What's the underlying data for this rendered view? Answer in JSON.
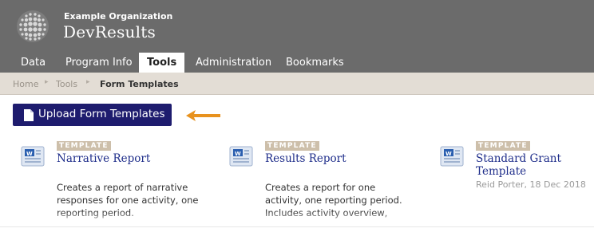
{
  "header": {
    "organization": "Example Organization",
    "app_name": "DevResults",
    "logo_icon": "dot-grid-logo-icon",
    "background": "#6b6b6b"
  },
  "nav": {
    "tabs": [
      {
        "label": "Data",
        "active": false
      },
      {
        "label": "Program Info",
        "active": false
      },
      {
        "label": "Tools",
        "active": true
      },
      {
        "label": "Administration",
        "active": false
      },
      {
        "label": "Bookmarks",
        "active": false
      }
    ]
  },
  "breadcrumb": {
    "items": [
      "Home",
      "Tools",
      "Form Templates"
    ],
    "separator_icon": "triangle-right-icon"
  },
  "actions": {
    "upload_label": "Upload Form Templates",
    "upload_icon": "document-icon",
    "button_color": "#1e1c6e",
    "pointer_icon": "orange-arrow-left-icon",
    "pointer_color": "#e8921e"
  },
  "templates": [
    {
      "badge": "TEMPLATE",
      "title": "Narrative Report",
      "description": "Creates a report of narrative responses for one activity, one reporting period.",
      "meta": "",
      "icon": "word-document-icon"
    },
    {
      "badge": "TEMPLATE",
      "title": "Results Report",
      "description": "Creates a report for one activity, one reporting period. Includes activity overview,",
      "meta": "",
      "icon": "word-document-icon"
    },
    {
      "badge": "TEMPLATE",
      "title": "Standard Grant Template",
      "description": "",
      "meta": "Reid Porter, 18 Dec 2018",
      "icon": "word-document-icon"
    }
  ]
}
